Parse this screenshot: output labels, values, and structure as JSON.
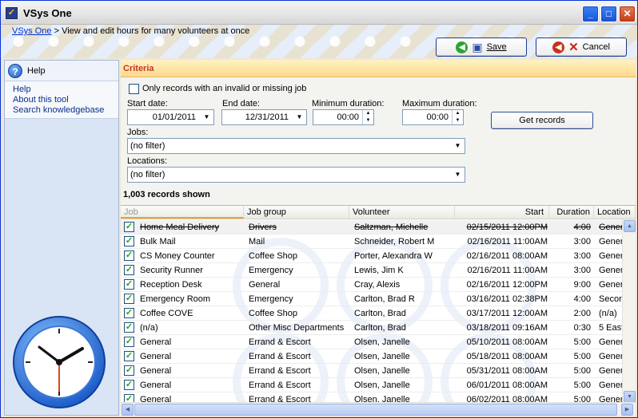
{
  "window": {
    "title": "VSys One",
    "icon": "vsys-logo-icon"
  },
  "title_buttons": {
    "minimize": "_",
    "maximize": "□",
    "close": "✕"
  },
  "breadcrumb": {
    "link": "VSys One",
    "separator": ">",
    "text": "View and edit hours for many volunteers at once"
  },
  "toolbar": {
    "save_label": "Save",
    "cancel_label": "Cancel"
  },
  "sidebar": {
    "header": "Help",
    "links": [
      "Help",
      "About this tool",
      "Search knowledgebase"
    ]
  },
  "criteria": {
    "title": "Criteria",
    "invalid_job_label": "Only records with an invalid or missing job",
    "invalid_job_checked": false,
    "start_date_label": "Start date:",
    "start_date": "01/01/2011",
    "end_date_label": "End date:",
    "end_date": "12/31/2011",
    "min_duration_label": "Minimum duration:",
    "min_duration": "00:00",
    "max_duration_label": "Maximum duration:",
    "max_duration": "00:00",
    "get_records_label": "Get records",
    "jobs_label": "Jobs:",
    "jobs_value": "(no filter)",
    "locations_label": "Locations:",
    "locations_value": "(no filter)"
  },
  "records_count": "1,003 records shown",
  "grid": {
    "columns": [
      "Job",
      "Job group",
      "Volunteer",
      "Start",
      "Duration",
      "Location"
    ],
    "rows": [
      {
        "checked": true,
        "job": "Home Meal Delivery",
        "group": "Drivers",
        "volunteer": "Saltzman, Michelle",
        "start": "02/15/2011 12:00PM",
        "duration": "4:00",
        "location": "Gener",
        "strike": true
      },
      {
        "checked": true,
        "job": "Bulk Mail",
        "group": "Mail",
        "volunteer": "Schneider, Robert M",
        "start": "02/16/2011 11:00AM",
        "duration": "3:00",
        "location": "Gener",
        "strike": false
      },
      {
        "checked": true,
        "job": "CS Money Counter",
        "group": "Coffee Shop",
        "volunteer": "Porter, Alexandra W",
        "start": "02/16/2011 08:00AM",
        "duration": "3:00",
        "location": "Gener",
        "strike": false
      },
      {
        "checked": true,
        "job": "Security Runner",
        "group": "Emergency",
        "volunteer": "Lewis, Jim K",
        "start": "02/16/2011 11:00AM",
        "duration": "3:00",
        "location": "Gener",
        "strike": false
      },
      {
        "checked": true,
        "job": "Reception Desk",
        "group": "General",
        "volunteer": "Cray, Alexis",
        "start": "02/16/2011 12:00PM",
        "duration": "9:00",
        "location": "Gener",
        "strike": false
      },
      {
        "checked": true,
        "job": "Emergency Room",
        "group": "Emergency",
        "volunteer": "Carlton, Brad R",
        "start": "03/16/2011 02:38PM",
        "duration": "4:00",
        "location": "Secor",
        "strike": false
      },
      {
        "checked": true,
        "job": "Coffee COVE",
        "group": "Coffee Shop",
        "volunteer": "Carlton, Brad",
        "start": "03/17/2011 12:00AM",
        "duration": "2:00",
        "location": "(n/a)",
        "strike": false
      },
      {
        "checked": true,
        "job": "(n/a)",
        "group": "Other Misc Departments",
        "volunteer": "Carlton, Brad",
        "start": "03/18/2011 09:16AM",
        "duration": "0:30",
        "location": "5 East",
        "strike": false
      },
      {
        "checked": true,
        "job": "General",
        "group": "Errand & Escort",
        "volunteer": "Olsen, Janelle",
        "start": "05/10/2011 08:00AM",
        "duration": "5:00",
        "location": "Gener",
        "strike": false
      },
      {
        "checked": true,
        "job": "General",
        "group": "Errand & Escort",
        "volunteer": "Olsen, Janelle",
        "start": "05/18/2011 08:00AM",
        "duration": "5:00",
        "location": "Gener",
        "strike": false
      },
      {
        "checked": true,
        "job": "General",
        "group": "Errand & Escort",
        "volunteer": "Olsen, Janelle",
        "start": "05/31/2011 08:00AM",
        "duration": "5:00",
        "location": "Gener",
        "strike": false
      },
      {
        "checked": true,
        "job": "General",
        "group": "Errand & Escort",
        "volunteer": "Olsen, Janelle",
        "start": "06/01/2011 08:00AM",
        "duration": "5:00",
        "location": "Gener",
        "strike": false
      },
      {
        "checked": true,
        "job": "General",
        "group": "Errand & Escort",
        "volunteer": "Olsen, Janelle",
        "start": "06/02/2011 08:00AM",
        "duration": "5:00",
        "location": "Gener",
        "strike": false
      }
    ]
  },
  "colors": {
    "accent_blue": "#1C3A8A",
    "criteria_text": "#C0392B",
    "save_green": "#2FA32F",
    "cancel_red": "#C8341A"
  }
}
